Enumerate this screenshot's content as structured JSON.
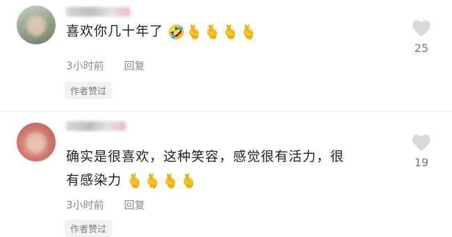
{
  "comments": [
    {
      "text": "喜欢你几十年了",
      "emojis": "🤣🫰🫰🫰🫰",
      "time": "3小时前",
      "reply_label": "回复",
      "badge": "作者赞过",
      "likes": "25"
    },
    {
      "text_line1": "确实是很喜欢，这种笑容，感觉很有活力，很",
      "text_line2": "有感染力",
      "emojis": "🫰🫰🫰🫰",
      "time": "3小时前",
      "reply_label": "回复",
      "badge": "作者赞过",
      "likes": "19"
    }
  ]
}
